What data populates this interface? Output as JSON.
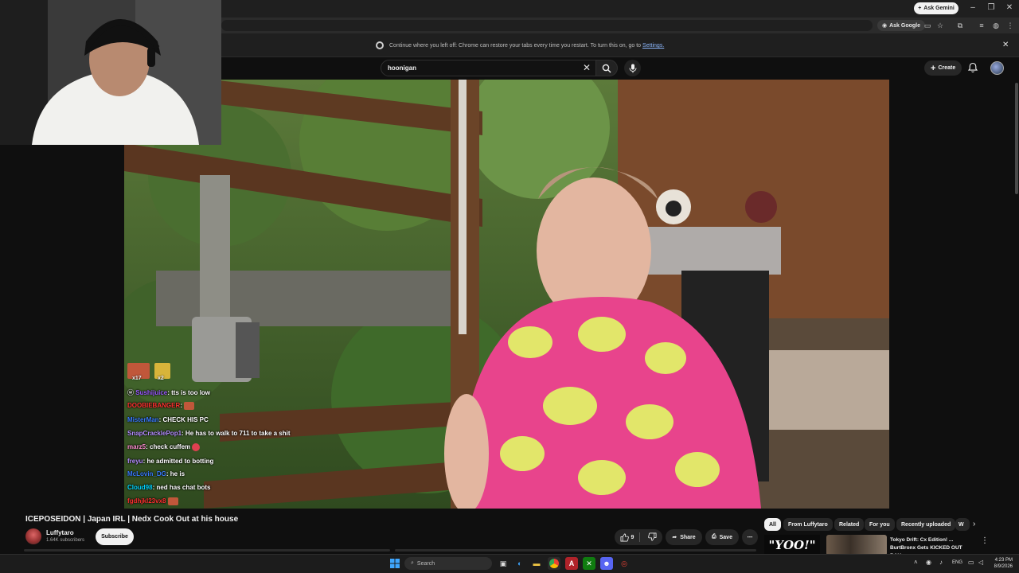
{
  "browser": {
    "ask_gemini_label": "Ask Gemini",
    "ask_google_label": "Ask Google",
    "restore_message": "Continue where you left off: Chrome can restore your tabs every time you restart. To turn this on, go to",
    "restore_link": "Settings."
  },
  "youtube": {
    "search_query": "hoonigan",
    "create_label": "Create",
    "video": {
      "title": "ICEPOSEIDON | Japan IRL | Nedx Cook Out at his house",
      "channel_name": "Luffytaro",
      "subscribers": "1.64K subscribers",
      "subscribe_label": "Subscribe",
      "like_count": "9",
      "share_label": "Share",
      "save_label": "Save"
    },
    "chips": [
      "All",
      "From Luffytaro",
      "Related",
      "For you",
      "Recently uploaded",
      "W"
    ],
    "recommendation": {
      "thumb_text": "\"YOO!\"",
      "title": "Tokyo Drift: Cx Edition! ... BurtBronx Gets KICKED OUT BAU..."
    }
  },
  "chat": {
    "badges": [
      "x17",
      "x2"
    ],
    "messages": [
      {
        "user": "Sushijuice",
        "text": ": tts is too low",
        "color": "#9b59ff"
      },
      {
        "user": "DOOBIEBANGER",
        "text": ":",
        "color": "#ff3030"
      },
      {
        "user": "MisterMan",
        "text": ": CHECK HIS PC",
        "color": "#3a7bff"
      },
      {
        "user": "SnapCracklePop1",
        "text": ": He has to walk to 711 to take a shit",
        "color": "#b48cff"
      },
      {
        "user": "marz5",
        "text": ": check cuffem",
        "color": "#ff8fd1"
      },
      {
        "user": "freyu",
        "text": ": he admitted to botting",
        "color": "#b48cff"
      },
      {
        "user": "McLovin_DG",
        "text": ": he is",
        "color": "#3a7bff"
      },
      {
        "user": "Cloud98",
        "text": ": ned has chat bots",
        "color": "#00d5ff"
      },
      {
        "user": "fgdhjkl23vx8",
        "text": "",
        "color": "#ff3030"
      }
    ]
  },
  "taskbar": {
    "search_placeholder": "Search",
    "language": "ENG",
    "time": "4:23 PM",
    "date": "8/9/2026"
  }
}
